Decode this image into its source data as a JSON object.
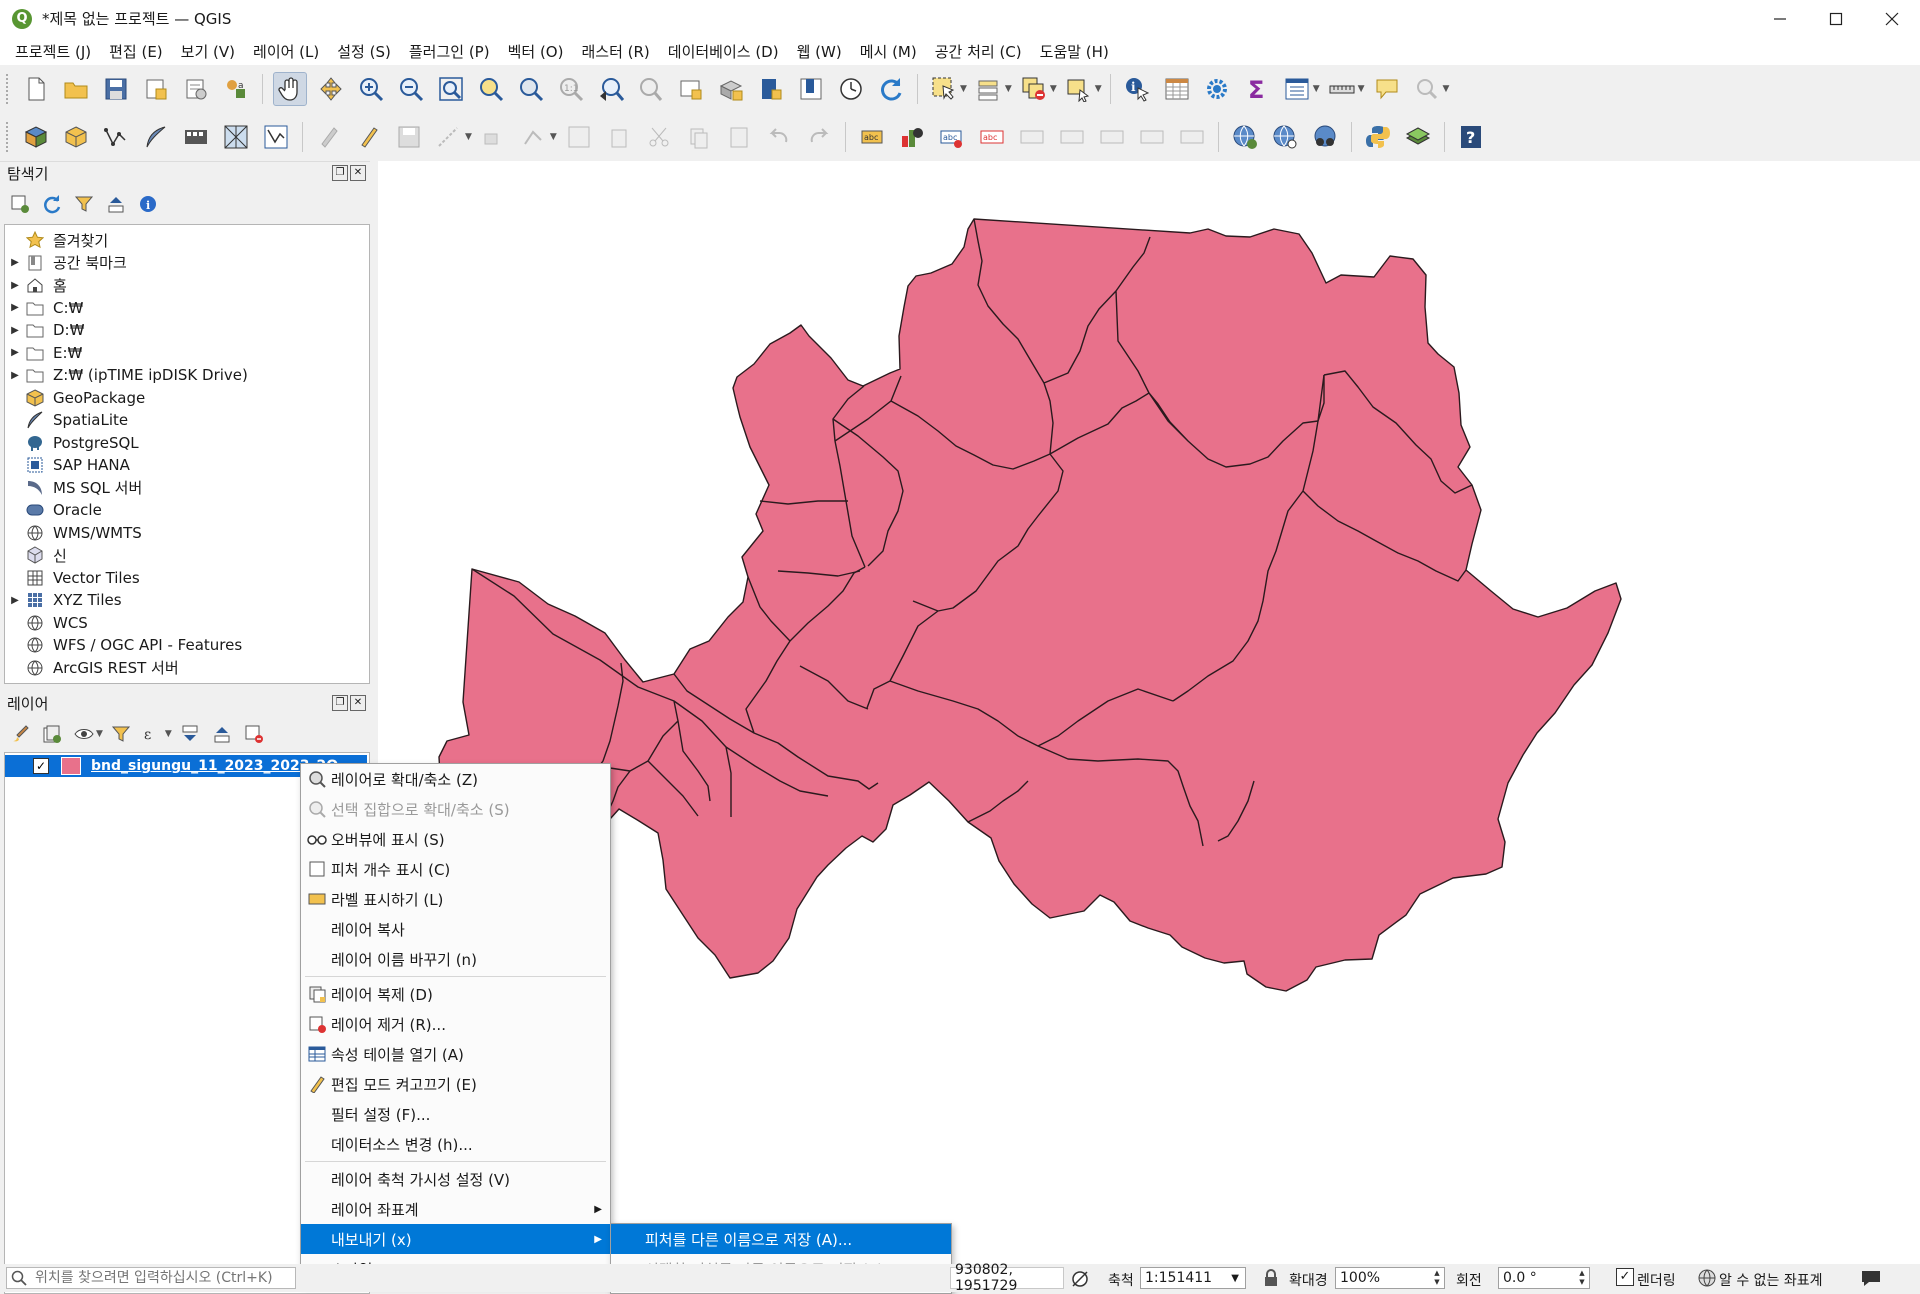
{
  "window": {
    "title": "*제목 없는 프로젝트 — QGIS",
    "app_logo": "Q"
  },
  "menubar": [
    "프로젝트 (J)",
    "편집 (E)",
    "보기 (V)",
    "레이어 (L)",
    "설정 (S)",
    "플러그인 (P)",
    "벡터 (O)",
    "래스터 (R)",
    "데이터베이스 (D)",
    "웹 (W)",
    "메시 (M)",
    "공간 처리 (C)",
    "도움말 (H)"
  ],
  "browser_panel": {
    "title": "탐색기",
    "items": [
      {
        "label": "즐겨찾기",
        "icon": "star-icon",
        "expandable": false
      },
      {
        "label": "공간 북마크",
        "icon": "bookmark-icon",
        "expandable": true
      },
      {
        "label": "홈",
        "icon": "home-icon",
        "expandable": true
      },
      {
        "label": "C:₩",
        "icon": "folder-icon",
        "expandable": true
      },
      {
        "label": "D:₩",
        "icon": "folder-icon",
        "expandable": true
      },
      {
        "label": "E:₩",
        "icon": "folder-icon",
        "expandable": true
      },
      {
        "label": "Z:₩ (ipTIME ipDISK Drive)",
        "icon": "folder-icon",
        "expandable": true
      },
      {
        "label": "GeoPackage",
        "icon": "geopackage-icon",
        "expandable": false
      },
      {
        "label": "SpatiaLite",
        "icon": "spatialite-icon",
        "expandable": false
      },
      {
        "label": "PostgreSQL",
        "icon": "postgresql-icon",
        "expandable": false
      },
      {
        "label": "SAP HANA",
        "icon": "sap-hana-icon",
        "expandable": false
      },
      {
        "label": "MS SQL 서버",
        "icon": "mssql-icon",
        "expandable": false
      },
      {
        "label": "Oracle",
        "icon": "oracle-icon",
        "expandable": false
      },
      {
        "label": "WMS/WMTS",
        "icon": "globe-icon",
        "expandable": false
      },
      {
        "label": "신",
        "icon": "cube-icon",
        "expandable": false
      },
      {
        "label": "Vector Tiles",
        "icon": "grid-icon",
        "expandable": false
      },
      {
        "label": "XYZ Tiles",
        "icon": "tiles-icon",
        "expandable": true
      },
      {
        "label": "WCS",
        "icon": "globe-icon",
        "expandable": false
      },
      {
        "label": "WFS / OGC API - Features",
        "icon": "globe-icon",
        "expandable": false
      },
      {
        "label": "ArcGIS REST 서버",
        "icon": "globe-icon",
        "expandable": false
      }
    ]
  },
  "layers_panel": {
    "title": "레이어",
    "layer": {
      "name": "bnd_sigungu_11_2023_2023_2Q",
      "checked": "✓",
      "color": "#e8718b"
    }
  },
  "context_menu": {
    "items": [
      {
        "label": "레이어로 확대/축소 (Z)",
        "icon": "zoom-layer-icon",
        "disabled": false
      },
      {
        "label": "선택 집합으로 확대/축소 (S)",
        "icon": "zoom-selection-icon",
        "disabled": true
      },
      {
        "label": "오버뷰에 표시 (S)",
        "icon": "overview-icon",
        "disabled": false
      },
      {
        "label": "피처 개수 표시 (C)",
        "icon": "checkbox-icon",
        "disabled": false
      },
      {
        "label": "라벨 표시하기 (L)",
        "icon": "label-icon",
        "disabled": false
      },
      {
        "label": "레이어 복사",
        "icon": "",
        "disabled": false
      },
      {
        "label": "레이어 이름 바꾸기 (n)",
        "icon": "",
        "disabled": false
      },
      {
        "sep": true
      },
      {
        "label": "레이어 복제 (D)",
        "icon": "duplicate-icon",
        "disabled": false
      },
      {
        "label": "레이어 제거 (R)...",
        "icon": "remove-icon",
        "disabled": false
      },
      {
        "label": "속성 테이블 열기 (A)",
        "icon": "table-icon",
        "disabled": false
      },
      {
        "label": "편집 모드 켜고끄기 (E)",
        "icon": "pencil-icon",
        "disabled": false
      },
      {
        "label": "필터 설정 (F)...",
        "icon": "",
        "disabled": false
      },
      {
        "label": "데이터소스 변경 (h)...",
        "icon": "",
        "disabled": false
      },
      {
        "sep": true
      },
      {
        "label": "레이어 축척 가시성 설정 (V)",
        "icon": "",
        "disabled": false
      },
      {
        "label": "레이어 좌표계",
        "icon": "",
        "disabled": false,
        "submenu": true
      },
      {
        "label": "내보내기 (x)",
        "icon": "",
        "disabled": false,
        "submenu": true,
        "highlight": true
      },
      {
        "label": "스타일",
        "icon": "",
        "disabled": false,
        "submenu": true
      }
    ],
    "submenu": [
      {
        "label": "피처를 다른 이름으로 저장 (A)...",
        "highlight": true,
        "disabled": false
      },
      {
        "label": "선택한 피처를 다른 이름으로 저장 (S)...",
        "highlight": false,
        "disabled": true
      }
    ]
  },
  "statusbar": {
    "locator_placeholder": "위치를 찾으려면 입력하십시오 (Ctrl+K)",
    "coordinate": "930802, 1951729",
    "scale_label": "축척",
    "scale_value": "1:151411",
    "magnifier_label": "확대경",
    "magnifier_value": "100%",
    "rotation_label": "회전",
    "rotation_value": "0.0 °",
    "render_label": "렌더링",
    "render_checked": "✓",
    "crs_label": "알 수 없는 좌표계"
  },
  "map": {
    "fill": "#e8718b",
    "stroke": "#2b1a1e"
  }
}
